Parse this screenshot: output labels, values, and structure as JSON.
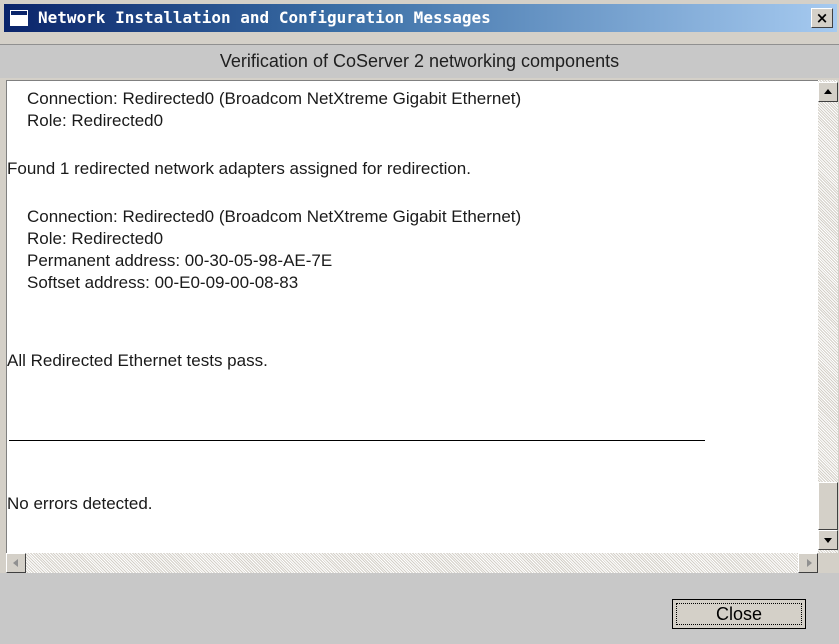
{
  "window": {
    "title": "Network Installation and Configuration Messages",
    "close_glyph": "×"
  },
  "header": {
    "text": "Verification of CoServer 2 networking components"
  },
  "log": {
    "lines": [
      "Connection: Redirected0 (Broadcom NetXtreme Gigabit Ethernet)",
      "Role: Redirected0",
      "Found 1 redirected network adapters assigned for redirection.",
      "Connection: Redirected0 (Broadcom NetXtreme Gigabit Ethernet)",
      "Role: Redirected0",
      "Permanent address: 00-30-05-98-AE-7E",
      "Softset address: 00-E0-09-00-08-83",
      "All Redirected Ethernet tests pass.",
      "No errors detected."
    ]
  },
  "footer": {
    "close_label": "Close"
  }
}
